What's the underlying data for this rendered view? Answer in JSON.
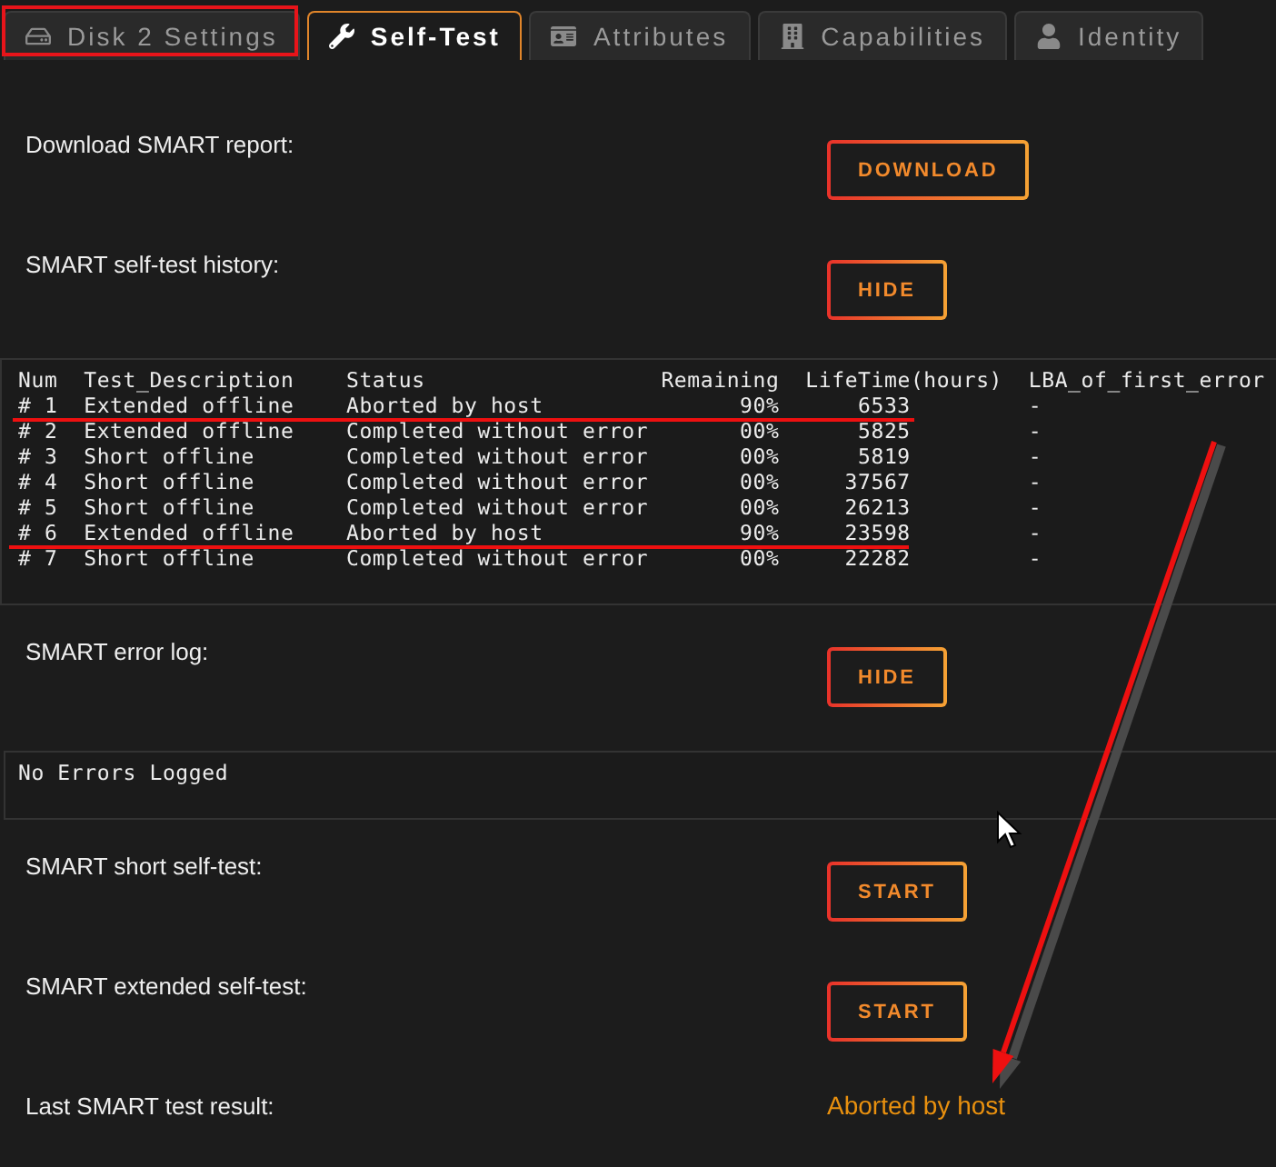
{
  "tabs": [
    {
      "label": "Disk 2 Settings",
      "selected": false
    },
    {
      "label": "Self-Test",
      "selected": true
    },
    {
      "label": "Attributes",
      "selected": false
    },
    {
      "label": "Capabilities",
      "selected": false
    },
    {
      "label": "Identity",
      "selected": false
    }
  ],
  "sections": [
    {
      "kind": "action",
      "label": "Download SMART report:",
      "button": "DOWNLOAD"
    },
    {
      "kind": "action",
      "label": "SMART self-test history:",
      "button": "HIDE"
    },
    {
      "kind": "table",
      "columns": [
        "Num",
        "Test_Description",
        "Status",
        "Remaining",
        "LifeTime(hours)",
        "LBA_of_first_error"
      ],
      "rows": [
        [
          "# 1",
          "Extended offline",
          "Aborted by host",
          "90%",
          "6533",
          "-"
        ],
        [
          "# 2",
          "Extended offline",
          "Completed without error",
          "00%",
          "5825",
          "-"
        ],
        [
          "# 3",
          "Short offline",
          "Completed without error",
          "00%",
          "5819",
          "-"
        ],
        [
          "# 4",
          "Short offline",
          "Completed without error",
          "00%",
          "37567",
          "-"
        ],
        [
          "# 5",
          "Short offline",
          "Completed without error",
          "00%",
          "26213",
          "-"
        ],
        [
          "# 6",
          "Extended offline",
          "Aborted by host",
          "90%",
          "23598",
          "-"
        ],
        [
          "# 7",
          "Short offline",
          "Completed without error",
          "00%",
          "22282",
          "-"
        ]
      ]
    },
    {
      "kind": "action",
      "label": "SMART error log:",
      "button": "HIDE"
    },
    {
      "kind": "log",
      "text": "No Errors Logged"
    },
    {
      "kind": "action",
      "label": "SMART short self-test:",
      "button": "START"
    },
    {
      "kind": "action",
      "label": "SMART extended self-test:",
      "button": "START"
    },
    {
      "kind": "result",
      "label": "Last SMART test result:",
      "value": "Aborted by host"
    }
  ]
}
